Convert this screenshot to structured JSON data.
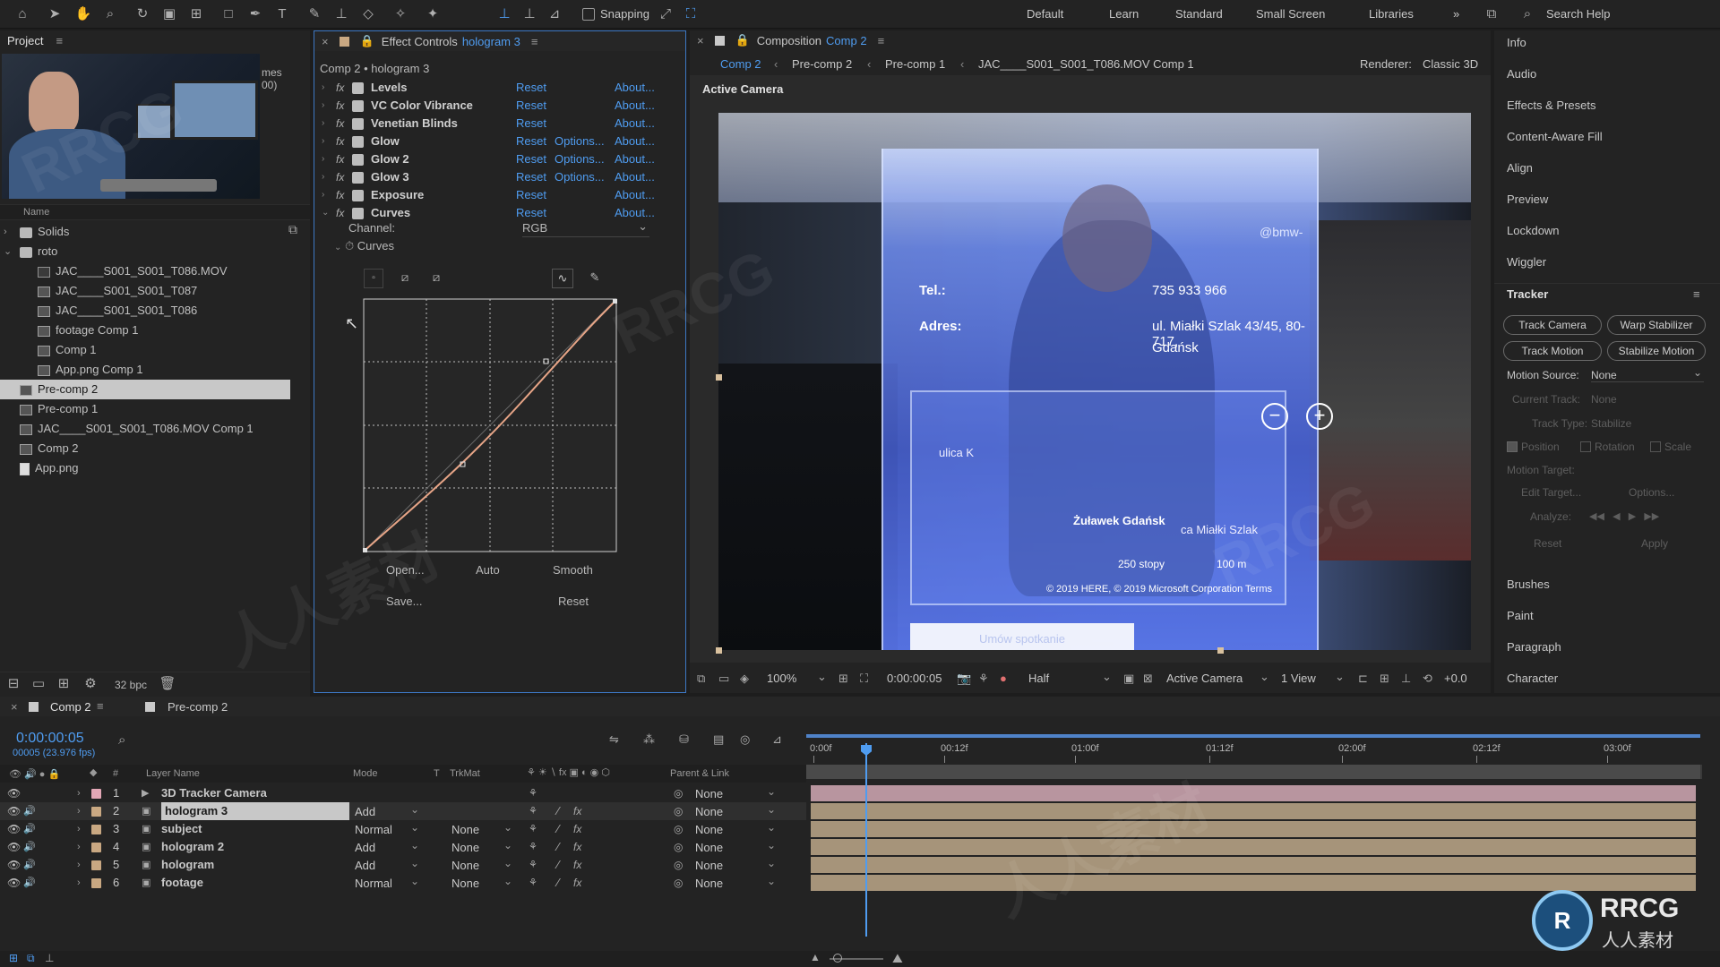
{
  "toolbar": {
    "snapping_label": "Snapping",
    "workspaces": [
      "Default",
      "Learn",
      "Standard",
      "Small Screen",
      "Libraries"
    ],
    "more": "»",
    "search_help": "Search Help"
  },
  "project": {
    "title": "Project",
    "name_col": "Name",
    "thumb_partial": "mes",
    "thumb_partial2": "00)",
    "items": [
      {
        "label": "Solids",
        "type": "folder",
        "indent": 0,
        "twirl": "›"
      },
      {
        "label": "roto",
        "type": "folder",
        "indent": 0,
        "twirl": "⌄"
      },
      {
        "label": "JAC____S001_S001_T086.MOV",
        "type": "footage",
        "indent": 2
      },
      {
        "label": "JAC____S001_S001_T087",
        "type": "comp",
        "indent": 2
      },
      {
        "label": "JAC____S001_S001_T086",
        "type": "comp",
        "indent": 2
      },
      {
        "label": "footage Comp 1",
        "type": "comp",
        "indent": 2
      },
      {
        "label": "Comp 1",
        "type": "comp",
        "indent": 2
      },
      {
        "label": "App.png Comp 1",
        "type": "comp",
        "indent": 2
      },
      {
        "label": "Pre-comp 2",
        "type": "comp",
        "indent": 1,
        "selected": true
      },
      {
        "label": "Pre-comp 1",
        "type": "comp",
        "indent": 1
      },
      {
        "label": "JAC____S001_S001_T086.MOV Comp 1",
        "type": "comp",
        "indent": 1
      },
      {
        "label": "Comp 2",
        "type": "comp",
        "indent": 1
      },
      {
        "label": "App.png",
        "type": "png",
        "indent": 1
      }
    ],
    "bpc": "32 bpc"
  },
  "effects": {
    "title": "Effect Controls",
    "layer": "hologram 3",
    "subtitle": "Comp 2 • hologram 3",
    "reset": "Reset",
    "options": "Options...",
    "about": "About...",
    "list": [
      {
        "name": "Levels",
        "has_options": false
      },
      {
        "name": "VC Color Vibrance",
        "has_options": false
      },
      {
        "name": "Venetian Blinds",
        "has_options": false
      },
      {
        "name": "Glow",
        "has_options": true
      },
      {
        "name": "Glow 2",
        "has_options": true
      },
      {
        "name": "Glow 3",
        "has_options": true
      },
      {
        "name": "Exposure",
        "has_options": false
      },
      {
        "name": "Curves",
        "has_options": false,
        "expanded": true
      }
    ],
    "channel_label": "Channel:",
    "channel_value": "RGB",
    "curves_label": "Curves",
    "buttons": {
      "open": "Open...",
      "auto": "Auto",
      "smooth": "Smooth",
      "save": "Save...",
      "reset": "Reset"
    }
  },
  "viewer": {
    "comp_tab_prefix": "Composition",
    "comp_tab_name": "Comp 2",
    "breadcrumbs": [
      "Comp 2",
      "Pre-comp 2",
      "Pre-comp 1",
      "JAC____S001_S001_T086.MOV Comp 1"
    ],
    "renderer_label": "Renderer:",
    "renderer_value": "Classic 3D",
    "camera_label": "Active Camera",
    "footage_text": {
      "tel_label": "Tel.:",
      "tel_value": "735 933 966",
      "addr_label": "Adres:",
      "addr_value_1": "ul. Miałki Szlak 43/45, 80-717,",
      "addr_value_2": "Gdańsk",
      "map_street": "ulica K",
      "map_poi": "Żuławek Gdańsk",
      "map_street2": "ca Miałki Szlak",
      "scale_1": "250 stopy",
      "scale_2": "100 m",
      "copyright": "© 2019 HERE, © 2019 Microsoft Corporation  Terms",
      "email": "@bmw-",
      "btn": "Umów spotkanie"
    },
    "bottom": {
      "zoom": "100%",
      "timecode": "0:00:00:05",
      "resolution": "Half",
      "view": "Active Camera",
      "views": "1 View",
      "exposure": "+0.0"
    }
  },
  "right_panel": {
    "items_top": [
      "Info",
      "Audio",
      "Effects & Presets",
      "Content-Aware Fill",
      "Align",
      "Preview",
      "Lockdown",
      "Wiggler"
    ],
    "tracker": {
      "title": "Tracker",
      "track_camera": "Track Camera",
      "warp_stabilizer": "Warp Stabilizer",
      "track_motion": "Track Motion",
      "stabilize_motion": "Stabilize Motion",
      "motion_source_label": "Motion Source:",
      "motion_source_value": "None",
      "current_track_label": "Current Track:",
      "current_track_value": "None",
      "track_type_label": "Track Type:",
      "track_type_value": "Stabilize",
      "position": "Position",
      "rotation": "Rotation",
      "scale": "Scale",
      "motion_target": "Motion Target:",
      "edit_target": "Edit Target...",
      "options": "Options...",
      "analyze": "Analyze:",
      "reset": "Reset",
      "apply": "Apply"
    },
    "items_bottom": [
      "Brushes",
      "Paint",
      "Paragraph",
      "Character"
    ]
  },
  "timeline": {
    "tab_active": "Comp 2",
    "tab_other": "Pre-comp 2",
    "timecode": "0:00:00:05",
    "fps": "00005 (23.976 fps)",
    "columns": {
      "num": "#",
      "layer_name": "Layer Name",
      "mode": "Mode",
      "t": "T",
      "trkmat": "TrkMat",
      "parent": "Parent & Link"
    },
    "ruler": [
      "0:00f",
      "00:12f",
      "01:00f",
      "01:12f",
      "02:00f",
      "02:12f",
      "03:00f"
    ],
    "layers": [
      {
        "num": "1",
        "name": "3D Tracker Camera",
        "mode": "",
        "trkmat": "",
        "parent": "None",
        "color": "#e3a7b6",
        "camera": true
      },
      {
        "num": "2",
        "name": "hologram 3",
        "mode": "Add",
        "trkmat": "",
        "parent": "None",
        "color": "#c9a882",
        "selected": true
      },
      {
        "num": "3",
        "name": "subject",
        "mode": "Normal",
        "trkmat": "None",
        "parent": "None",
        "color": "#c9a882"
      },
      {
        "num": "4",
        "name": "hologram 2",
        "mode": "Add",
        "trkmat": "None",
        "parent": "None",
        "color": "#c9a882"
      },
      {
        "num": "5",
        "name": "hologram",
        "mode": "Add",
        "trkmat": "None",
        "parent": "None",
        "color": "#c9a882"
      },
      {
        "num": "6",
        "name": "footage",
        "mode": "Normal",
        "trkmat": "None",
        "parent": "None",
        "color": "#c9a882"
      }
    ]
  },
  "watermark": {
    "brand": "RRCG",
    "brand_sub": "人人素材",
    "cn": "人人素材"
  },
  "colors": {
    "accent": "#4f9cf0",
    "selection": "#c8c8c8",
    "camera_bar": "#b8959f",
    "layer_bar": "#a6947a"
  }
}
